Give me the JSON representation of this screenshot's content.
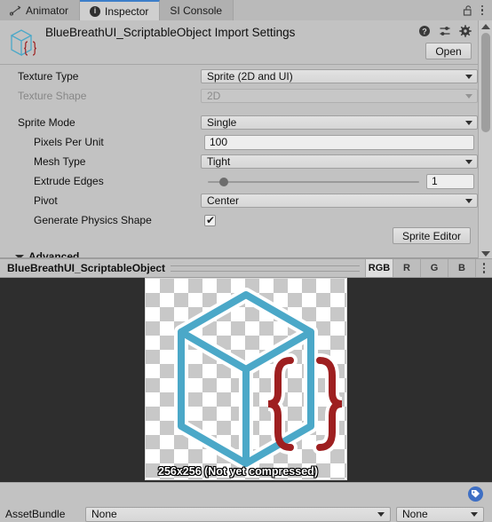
{
  "window": {
    "tabs": [
      {
        "label": "Animator",
        "icon": "animator-icon",
        "active": false
      },
      {
        "label": "Inspector",
        "icon": "info-icon",
        "active": true
      },
      {
        "label": "SI Console",
        "icon": "none",
        "active": false
      }
    ],
    "lock_icon": "padlock-open-icon",
    "menu_icon": "kebab-menu-icon"
  },
  "header": {
    "asset_icon": "scriptable-object-cube-icon",
    "title": "BlueBreathUI_ScriptableObject Import Settings",
    "icons": [
      {
        "name": "help-icon",
        "glyph": "?"
      },
      {
        "name": "preset-icon",
        "glyph": "preset"
      },
      {
        "name": "gear-icon",
        "glyph": "gear"
      }
    ],
    "open_label": "Open"
  },
  "settings": {
    "texture_type": {
      "label": "Texture Type",
      "value": "Sprite (2D and UI)"
    },
    "texture_shape": {
      "label": "Texture Shape",
      "value": "2D",
      "disabled": true
    },
    "sprite_mode": {
      "label": "Sprite Mode",
      "value": "Single"
    },
    "pixels_per_unit": {
      "label": "Pixels Per Unit",
      "value": "100"
    },
    "mesh_type": {
      "label": "Mesh Type",
      "value": "Tight"
    },
    "extrude_edges": {
      "label": "Extrude Edges",
      "value": "1"
    },
    "pivot": {
      "label": "Pivot",
      "value": "Center"
    },
    "generate_physics_shape": {
      "label": "Generate Physics Shape",
      "checked": true
    },
    "sprite_editor_label": "Sprite Editor",
    "advanced_label": "Advanced"
  },
  "preview": {
    "title": "BlueBreathUI_ScriptableObject",
    "channels": [
      {
        "label": "RGB",
        "selected": true
      },
      {
        "label": "R",
        "selected": false
      },
      {
        "label": "G",
        "selected": false
      },
      {
        "label": "B",
        "selected": false
      }
    ],
    "menu_icon": "kebab-menu-icon",
    "caption": "256x256 (Not yet compressed)",
    "sprite_colors": {
      "cube": "#4BA8C8",
      "braces": "#9E1F20"
    }
  },
  "footer": {
    "tag_icon": "asset-label-tag-icon",
    "assetbundle_label": "AssetBundle",
    "assetbundle_name": "None",
    "assetbundle_variant": "None"
  }
}
